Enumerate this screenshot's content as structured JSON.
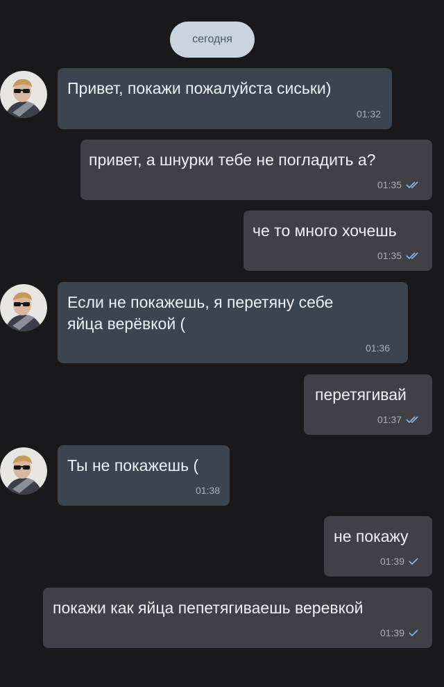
{
  "date_label": "сегодня",
  "colors": {
    "background": "#19191b",
    "incoming_bubble": "#3a4550",
    "outgoing_bubble": "#404046",
    "date_pill": "#c9d4df",
    "read_check": "#8fb4e6"
  },
  "messages": [
    {
      "direction": "incoming",
      "text": "Привет, покажи пожалуйста сиськи)",
      "time": "01:32"
    },
    {
      "direction": "outgoing",
      "text": "привет, а шнурки тебе не погладить а?",
      "time": "01:35",
      "status": "read"
    },
    {
      "direction": "outgoing",
      "text": "че то много хочешь",
      "time": "01:35",
      "status": "read"
    },
    {
      "direction": "incoming",
      "text_lines": [
        "Если не покажешь, я перетяну себе",
        "яйца верёвкой ("
      ],
      "time": "01:36"
    },
    {
      "direction": "outgoing",
      "text": "перетягивай",
      "time": "01:37",
      "status": "read"
    },
    {
      "direction": "incoming",
      "text": "Ты не покажешь (",
      "time": "01:38"
    },
    {
      "direction": "outgoing",
      "text": "не покажу",
      "time": "01:39",
      "status": "sent"
    },
    {
      "direction": "outgoing",
      "text": "покажи как яйца пепетягиваешь веревкой",
      "time": "01:39",
      "status": "sent"
    }
  ]
}
